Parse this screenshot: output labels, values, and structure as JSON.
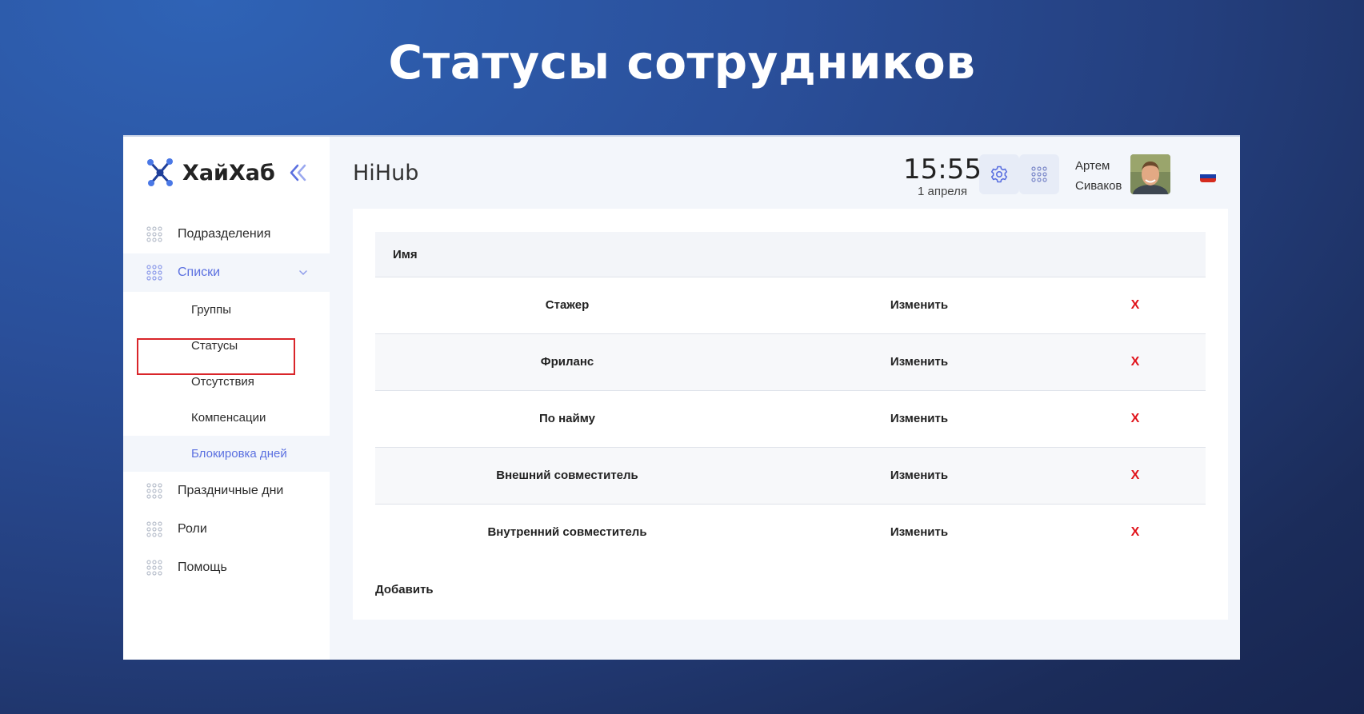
{
  "slide": {
    "title": "Статусы сотрудников"
  },
  "app": {
    "logo_text": "ХайХаб",
    "header_title": "HiHub",
    "accent_color": "#5b70e0",
    "delete_color": "#e0121a"
  },
  "sidebar": {
    "items": [
      {
        "label": "Подразделения",
        "icon": "grid-dots-icon"
      },
      {
        "label": "Списки",
        "icon": "grid-dots-icon",
        "active": true,
        "expanded": true
      },
      {
        "label": "Праздничные дни",
        "icon": "grid-dots-icon"
      },
      {
        "label": "Роли",
        "icon": "grid-dots-icon"
      },
      {
        "label": "Помощь",
        "icon": "grid-dots-icon"
      }
    ],
    "subitems": [
      {
        "label": "Группы"
      },
      {
        "label": "Статусы",
        "selected": true
      },
      {
        "label": "Отсутствия"
      },
      {
        "label": "Компенсации"
      },
      {
        "label": "Блокировка дней"
      }
    ]
  },
  "header": {
    "time": "15:55",
    "date": "1 апреля",
    "user_first": "Артем",
    "user_last": "Сиваков",
    "settings_icon": "gear-icon",
    "apps_icon": "grid-dots-icon",
    "language_flag": "russia-flag-icon"
  },
  "table": {
    "column_name": "Имя",
    "rows": [
      {
        "name": "Стажер",
        "edit": "Изменить",
        "delete": "X"
      },
      {
        "name": "Фриланс",
        "edit": "Изменить",
        "delete": "X"
      },
      {
        "name": "По найму",
        "edit": "Изменить",
        "delete": "X"
      },
      {
        "name": "Внешний совместитель",
        "edit": "Изменить",
        "delete": "X"
      },
      {
        "name": "Внутренний совместитель",
        "edit": "Изменить",
        "delete": "X"
      }
    ],
    "add_label": "Добавить"
  }
}
